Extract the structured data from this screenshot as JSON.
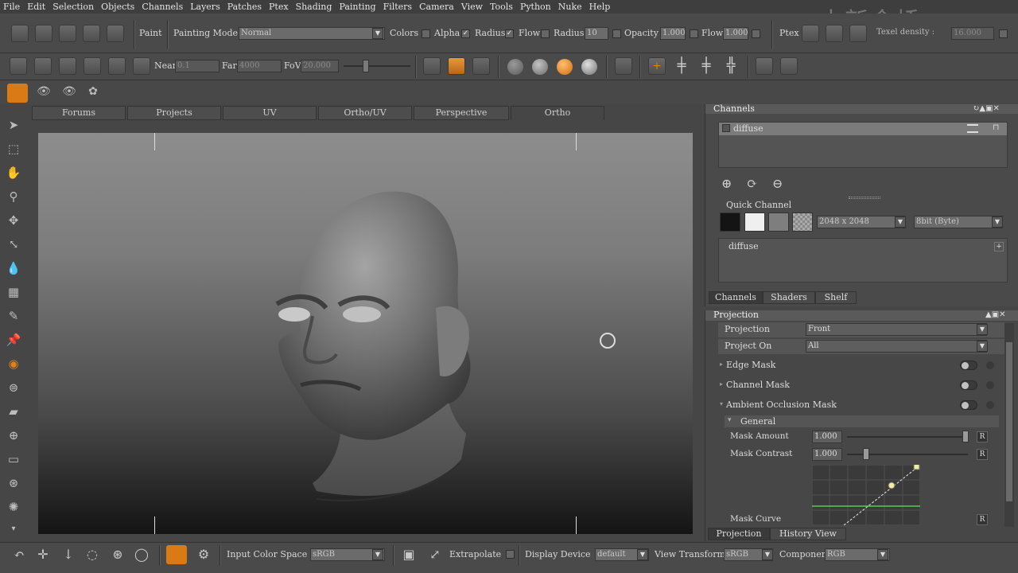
{
  "menu": [
    "File",
    "Edit",
    "Selection",
    "Objects",
    "Channels",
    "Layers",
    "Patches",
    "Ptex",
    "Shading",
    "Painting",
    "Filters",
    "Camera",
    "View",
    "Tools",
    "Python",
    "Nuke",
    "Help"
  ],
  "watermark": "中新金桥",
  "toolbar1": {
    "paint_label": "Paint",
    "painting_mode_label": "Painting Mode",
    "painting_mode_value": "Normal",
    "colors_label": "Colors",
    "alpha_label": "Alpha",
    "radius_check_label": "Radius",
    "flow_check_label": "Flow",
    "radius_label": "Radius",
    "radius_value": "10",
    "opacity_label": "Opacity",
    "opacity_value": "1.000",
    "flow_label": "Flow",
    "flow_value": "1.000",
    "ptex_label": "Ptex",
    "texel_density_label": "Texel density :",
    "texel_density_value": "16.000"
  },
  "toolbar2": {
    "near_label": "Near",
    "near_value": "0.1",
    "far_label": "Far",
    "far_value": "4000",
    "fov_label": "FoV",
    "fov_value": "20.000"
  },
  "viewport_tabs": [
    "Forums",
    "Projects",
    "UV",
    "Ortho/UV",
    "Perspective",
    "Ortho"
  ],
  "active_viewport_tab": "Ortho",
  "channels_panel": {
    "title": "Channels",
    "channel_name": "diffuse",
    "quick_channel_label": "Quick Channel",
    "resolution": "2048 x 2048",
    "depth": "8bit  (Byte)",
    "quick_channel_entry": "diffuse",
    "tabs": [
      "Channels",
      "Shaders",
      "Shelf"
    ]
  },
  "projection_panel": {
    "title": "Projection",
    "projection_label": "Projection",
    "projection_value": "Front",
    "project_on_label": "Project On",
    "project_on_value": "All",
    "edge_mask": "Edge Mask",
    "channel_mask": "Channel Mask",
    "ao_mask": "Ambient Occlusion Mask",
    "general": "General",
    "mask_amount_label": "Mask Amount",
    "mask_amount_value": "1.000",
    "mask_contrast_label": "Mask Contrast",
    "mask_contrast_value": "1.000",
    "mask_curve_label": "Mask Curve",
    "reset": "R",
    "tabs": [
      "Projection",
      "History View"
    ]
  },
  "bottom_bar": {
    "input_color_space_label": "Input Color Space",
    "input_color_space_value": "sRGB",
    "extrapolate_label": "Extrapolate",
    "display_device_label": "Display Device",
    "display_device_value": "default",
    "view_transform_label": "View Transform",
    "view_transform_value": "sRGB",
    "component_label": "Component",
    "component_value": "RGB"
  },
  "colors": {
    "accent": "#e0801c",
    "panel": "#464646",
    "viewport_top": "#8a8a8a",
    "viewport_bottom": "#121212"
  }
}
